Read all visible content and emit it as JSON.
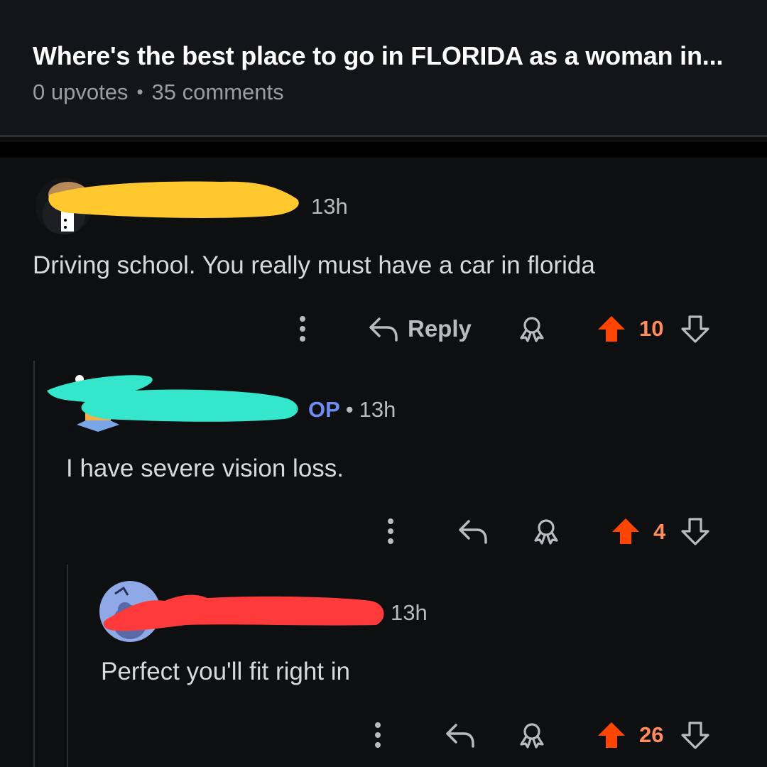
{
  "post": {
    "title": "Where's the best place to go in FLORIDA as a woman in...",
    "upvotes": "0 upvotes",
    "separator": "•",
    "comments": "35 comments"
  },
  "comments": [
    {
      "time": "13h",
      "body": "Driving school. You really must have a car in florida",
      "reply_label": "Reply",
      "score": "10",
      "redaction_color": "#ffc82e"
    },
    {
      "op_badge": "OP",
      "separator": "•",
      "time": "13h",
      "body": "I have severe vision loss.",
      "score": "4",
      "redaction_color": "#33e6cc"
    },
    {
      "time": "13h",
      "body": "Perfect you'll fit right in",
      "score": "26",
      "redaction_color": "#ff3a3a"
    }
  ],
  "colors": {
    "background": "#0e0f11",
    "header": "#141518",
    "upvote_active": "#ff4500",
    "score": "#ff8c5a",
    "op_badge": "#6f8cf2",
    "icon": "#b8bbbf"
  },
  "icons": [
    "more-vertical-icon",
    "reply-arrow-icon",
    "award-icon",
    "upvote-arrow-icon",
    "downvote-arrow-icon"
  ]
}
